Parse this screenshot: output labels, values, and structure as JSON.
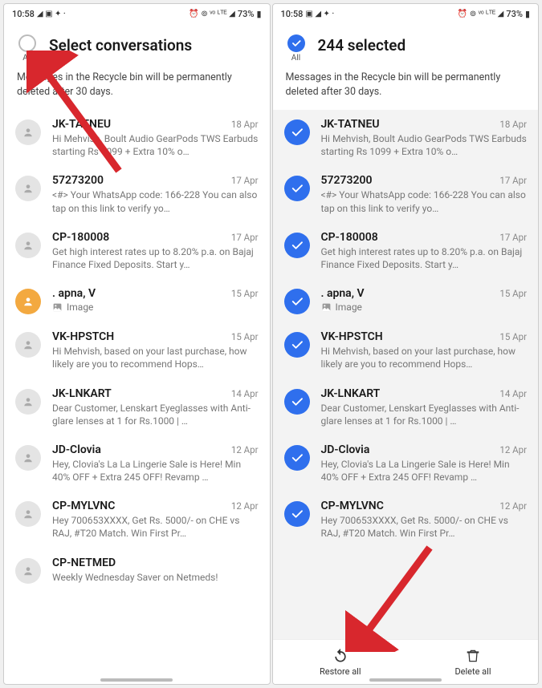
{
  "status": {
    "time": "10:58",
    "battery": "73%"
  },
  "left": {
    "title": "Select conversations",
    "all_label": "All",
    "subtitle": "Messages in the Recycle bin will be permanently deleted after 30 days."
  },
  "right": {
    "title": "244 selected",
    "all_label": "All",
    "subtitle": "Messages in the Recycle bin will be permanently deleted after 30 days.",
    "restore": "Restore all",
    "delete": "Delete all"
  },
  "conversations": [
    {
      "sender": "JK-TATNEU",
      "date": "18 Apr",
      "preview": "Hi Mehvish, Boult Audio GearPods TWS Earbuds starting Rs 1099 + Extra 10% o…"
    },
    {
      "sender": "57273200",
      "date": "17 Apr",
      "preview": "<#> Your WhatsApp code: 166-228 You can also tap on this link to verify yo…"
    },
    {
      "sender": "CP-180008",
      "date": "17 Apr",
      "preview": "Get high interest rates up to 8.20% p.a. on Bajaj Finance Fixed Deposits. Start y…"
    },
    {
      "sender": ". apna, V",
      "date": "15 Apr",
      "preview": "Image",
      "image": true,
      "orange": true
    },
    {
      "sender": "VK-HPSTCH",
      "date": "15 Apr",
      "preview": "Hi Mehvish, based on your last purchase, how likely are you to recommend Hops…"
    },
    {
      "sender": "JK-LNKART",
      "date": "14 Apr",
      "preview": "Dear Customer, Lenskart Eyeglasses with Anti-glare lenses at 1 for Rs.1000 | …"
    },
    {
      "sender": "JD-Clovia",
      "date": "12 Apr",
      "preview": "Hey, Clovia's La La Lingerie Sale is Here! Min 40% OFF + Extra 245 OFF! Revamp …"
    },
    {
      "sender": "CP-MYLVNC",
      "date": "12 Apr",
      "preview": "Hey 700653XXXX,   Get Rs. 5000/- on CHE vs RAJ,   #T20 Match.   Win First Pr…"
    },
    {
      "sender": "CP-NETMED",
      "date": "",
      "preview": "Weekly Wednesday Saver on Netmeds!"
    }
  ]
}
